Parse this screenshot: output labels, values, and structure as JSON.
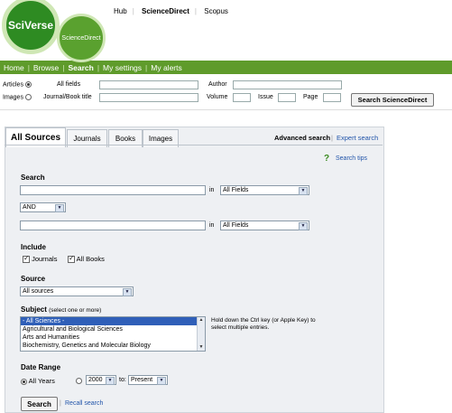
{
  "brand": {
    "sciverse": "SciVerse",
    "sciencedirect": "ScienceDirect"
  },
  "top_links": [
    "Hub",
    "ScienceDirect",
    "Scopus"
  ],
  "nav": [
    "Home",
    "Browse",
    "Search",
    "My settings",
    "My alerts"
  ],
  "quick_search": {
    "articles": "Articles",
    "images": "Images",
    "all_fields": "All fields",
    "journal_book_title": "Journal/Book title",
    "author": "Author",
    "volume": "Volume",
    "issue": "Issue",
    "page": "Page",
    "button": "Search ScienceDirect"
  },
  "tabs": [
    "All Sources",
    "Journals",
    "Books",
    "Images"
  ],
  "advanced_search": "Advanced search",
  "expert_search": "Expert search",
  "search_tips": "Search tips",
  "search": {
    "heading": "Search",
    "in_label": "in",
    "field1_select": "All Fields",
    "operator": "AND",
    "field2_select": "All Fields"
  },
  "include": {
    "heading": "Include",
    "journals": "Journals",
    "all_books": "All Books"
  },
  "source": {
    "heading": "Source",
    "selected": "All sources"
  },
  "subject": {
    "heading": "Subject",
    "note": "(select one or more)",
    "options": [
      "- All Sciences -",
      "Agricultural and Biological Sciences",
      "Arts and Humanities",
      "Biochemistry, Genetics and Molecular Biology"
    ],
    "hint": "Hold down the Ctrl key (or Apple Key) to select multiple entries."
  },
  "date_range": {
    "heading": "Date Range",
    "all_years": "All Years",
    "from": "2000",
    "to_label": "to:",
    "to": "Present"
  },
  "buttons": {
    "search": "Search",
    "recall": "Recall search"
  }
}
